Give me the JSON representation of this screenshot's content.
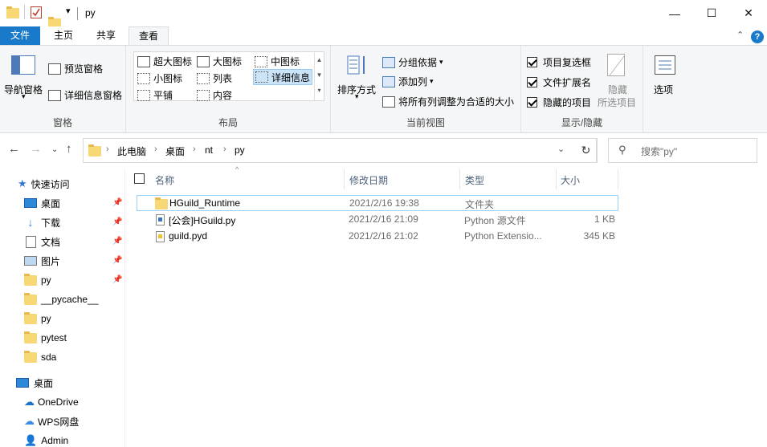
{
  "window": {
    "title": "py",
    "minimize": "—",
    "maximize": "☐",
    "close": "✕"
  },
  "quick_access_toolbar": {
    "dropdown": "▾"
  },
  "tabs": [
    {
      "label": "文件"
    },
    {
      "label": "主页"
    },
    {
      "label": "共享"
    },
    {
      "label": "查看"
    }
  ],
  "ribbon": {
    "panes_group": {
      "label": "窗格",
      "nav_pane": "导航窗格",
      "preview_pane": "预览窗格",
      "details_pane": "详细信息窗格"
    },
    "layout_group": {
      "label": "布局",
      "extra_large_icons": "超大图标",
      "large_icons": "大图标",
      "medium_icons": "中图标",
      "small_icons": "小图标",
      "list": "列表",
      "details": "详细信息",
      "tiles": "平铺",
      "content": "内容"
    },
    "current_view_group": {
      "label": "当前视图",
      "sort_by": "排序方式",
      "group_by": "分组依据",
      "add_columns": "添加列",
      "size_all_columns": "将所有列调整为合适的大小"
    },
    "show_hide_group": {
      "label": "显示/隐藏",
      "item_checkboxes": "项目复选框",
      "file_extensions": "文件扩展名",
      "hidden_items": "隐藏的项目",
      "hide_selected_line1": "隐藏",
      "hide_selected_line2": "所选项目",
      "options": "选项"
    }
  },
  "address_bar": {
    "breadcrumbs": [
      "此电脑",
      "桌面",
      "nt",
      "py"
    ],
    "search_placeholder": "搜索\"py\""
  },
  "sidebar": {
    "quick_access": "快速访问",
    "items": [
      {
        "label": "桌面",
        "pinned": true
      },
      {
        "label": "下载",
        "pinned": true
      },
      {
        "label": "文档",
        "pinned": true
      },
      {
        "label": "图片",
        "pinned": true
      },
      {
        "label": "py",
        "pinned": true
      },
      {
        "label": "__pycache__",
        "pinned": false
      },
      {
        "label": "py",
        "pinned": false
      },
      {
        "label": "pytest",
        "pinned": false
      },
      {
        "label": "sda",
        "pinned": false
      }
    ],
    "desktop": "桌面",
    "onedrive": "OneDrive",
    "wps": "WPS网盘",
    "admin": "Admin"
  },
  "file_list": {
    "columns": {
      "name": "名称",
      "modified": "修改日期",
      "type": "类型",
      "size": "大小"
    },
    "rows": [
      {
        "name": "HGuild_Runtime",
        "modified": "2021/2/16 19:38",
        "type": "文件夹",
        "size": "",
        "icon": "folder"
      },
      {
        "name": "[公会]HGuild.py",
        "modified": "2021/2/16 21:09",
        "type": "Python 源文件",
        "size": "1 KB",
        "icon": "python-file"
      },
      {
        "name": "guild.pyd",
        "modified": "2021/2/16 21:02",
        "type": "Python Extensio...",
        "size": "345 KB",
        "icon": "pyd-file"
      }
    ]
  },
  "colors": {
    "file_tab": "#1979ca",
    "ribbon_bg": "#f5f6f7",
    "selected_border": "#99d1ff",
    "folder": "#f8d775"
  }
}
